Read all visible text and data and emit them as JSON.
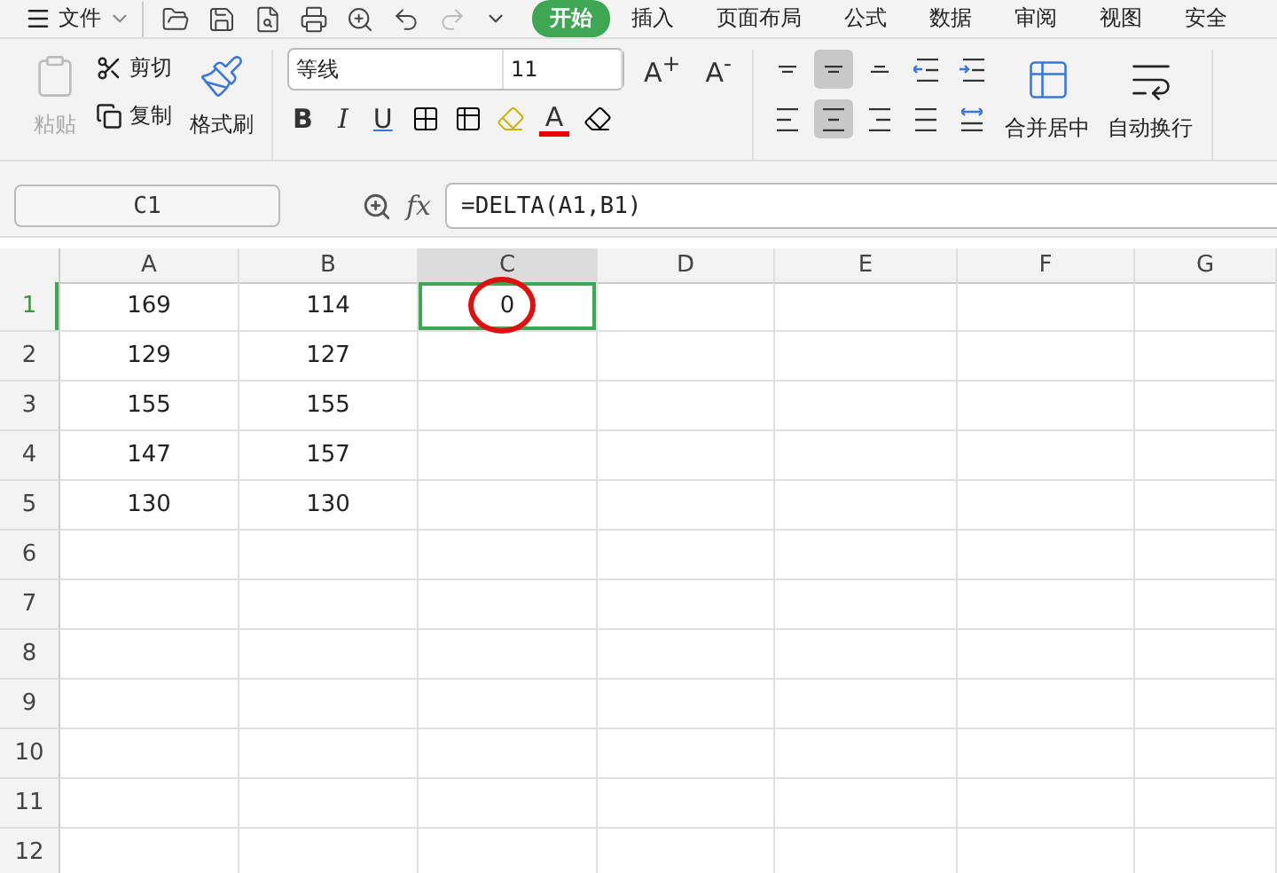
{
  "menu": {
    "file_label": "文件",
    "tabs": [
      {
        "label": "开始",
        "selected": true
      },
      {
        "label": "插入",
        "selected": false
      },
      {
        "label": "页面布局",
        "selected": false
      },
      {
        "label": "公式",
        "selected": false
      },
      {
        "label": "数据",
        "selected": false
      },
      {
        "label": "审阅",
        "selected": false
      },
      {
        "label": "视图",
        "selected": false
      },
      {
        "label": "安全",
        "selected": false
      }
    ]
  },
  "ribbon": {
    "paste": {
      "label": "粘贴",
      "disabled": true
    },
    "cut": "剪切",
    "copy": "复制",
    "format_painter": "格式刷",
    "font": {
      "name": "等线",
      "size": "11",
      "grow": "A$^{+}$",
      "shrink": "A$^{-}$",
      "bold": "B",
      "italic": "I",
      "underline": "U",
      "color_letter": "A"
    },
    "alignment": [
      {
        "kind": "top",
        "selected": false
      },
      {
        "kind": "middle",
        "selected": true
      },
      {
        "kind": "bottom",
        "selected": false
      },
      {
        "kind": "outdent",
        "selected": false
      },
      {
        "kind": "indent",
        "selected": false
      },
      {
        "kind": "left",
        "selected": false
      },
      {
        "kind": "center",
        "selected": true
      },
      {
        "kind": "right",
        "selected": false
      },
      {
        "kind": "justify",
        "selected": false
      },
      {
        "kind": "distributed",
        "selected": false
      }
    ],
    "merge": "合并居中",
    "wrap": "自动换行"
  },
  "formula_bar": {
    "cell_ref": "C1",
    "fx": "fx",
    "formula": "=DELTA(A1,B1)"
  },
  "sheet": {
    "highlight_circle": true,
    "columns": [
      {
        "label": "A",
        "selected": false
      },
      {
        "label": "B",
        "selected": false
      },
      {
        "label": "C",
        "selected": true
      },
      {
        "label": "D",
        "selected": false
      },
      {
        "label": "E",
        "selected": false
      },
      {
        "label": "F",
        "selected": false
      },
      {
        "label": "G",
        "selected": false
      }
    ],
    "rows": [
      {
        "label": "1",
        "selected": true,
        "cells": [
          "169",
          "114",
          "0"
        ]
      },
      {
        "label": "2",
        "selected": false,
        "cells": [
          "129",
          "127"
        ]
      },
      {
        "label": "3",
        "selected": false,
        "cells": [
          "155",
          "155"
        ]
      },
      {
        "label": "4",
        "selected": false,
        "cells": [
          "147",
          "157"
        ]
      },
      {
        "label": "5",
        "selected": false,
        "cells": [
          "130",
          "130"
        ]
      },
      {
        "label": "6",
        "selected": false,
        "cells": []
      },
      {
        "label": "7",
        "selected": false,
        "cells": []
      },
      {
        "label": "8",
        "selected": false,
        "cells": []
      },
      {
        "label": "9",
        "selected": false,
        "cells": []
      },
      {
        "label": "10",
        "selected": false,
        "cells": []
      },
      {
        "label": "11",
        "selected": false,
        "cells": []
      },
      {
        "label": "12",
        "selected": false,
        "cells": []
      }
    ]
  }
}
